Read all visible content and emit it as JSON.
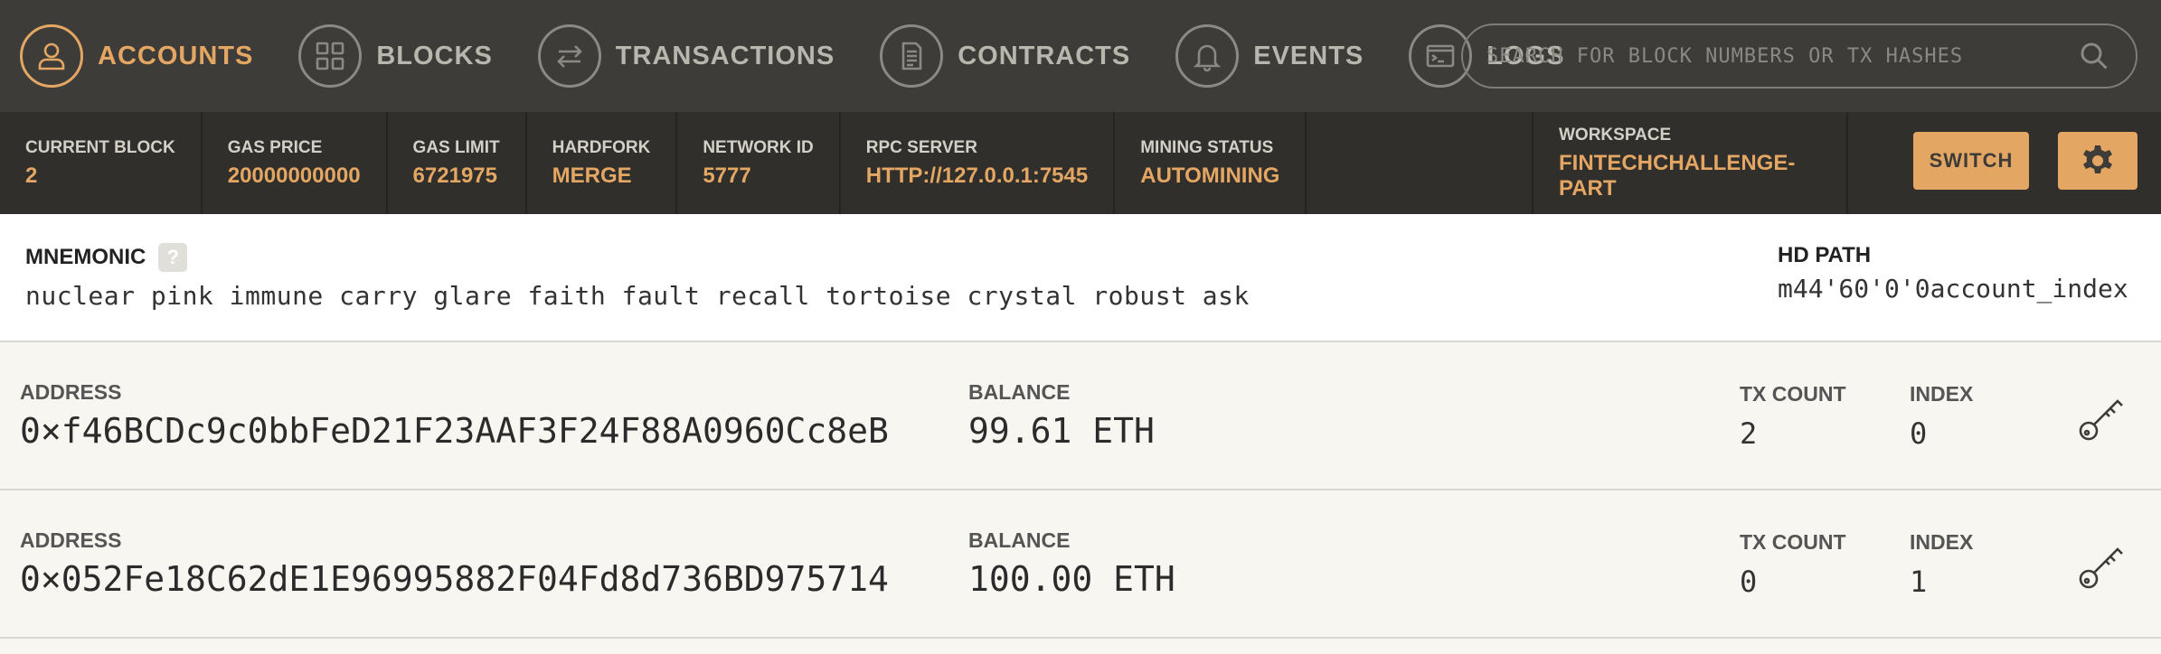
{
  "nav": {
    "items": [
      {
        "label": "ACCOUNTS",
        "icon": "user-icon",
        "active": true
      },
      {
        "label": "BLOCKS",
        "icon": "grid-icon",
        "active": false
      },
      {
        "label": "TRANSACTIONS",
        "icon": "arrows-icon",
        "active": false
      },
      {
        "label": "CONTRACTS",
        "icon": "document-icon",
        "active": false
      },
      {
        "label": "EVENTS",
        "icon": "bell-icon",
        "active": false
      },
      {
        "label": "LOGS",
        "icon": "terminal-icon",
        "active": false
      }
    ],
    "search_placeholder": "SEARCH FOR BLOCK NUMBERS OR TX HASHES"
  },
  "status": {
    "current_block": {
      "label": "CURRENT BLOCK",
      "value": "2"
    },
    "gas_price": {
      "label": "GAS PRICE",
      "value": "20000000000"
    },
    "gas_limit": {
      "label": "GAS LIMIT",
      "value": "6721975"
    },
    "hardfork": {
      "label": "HARDFORK",
      "value": "MERGE"
    },
    "network_id": {
      "label": "NETWORK ID",
      "value": "5777"
    },
    "rpc_server": {
      "label": "RPC SERVER",
      "value": "HTTP://127.0.0.1:7545"
    },
    "mining_status": {
      "label": "MINING STATUS",
      "value": "AUTOMINING"
    },
    "workspace": {
      "label": "WORKSPACE",
      "value": "FINTECHCHALLENGE-PART"
    },
    "switch_label": "SWITCH"
  },
  "mnemonic": {
    "label": "MNEMONIC",
    "help": "?",
    "words": "nuclear pink immune carry glare faith fault recall tortoise crystal robust ask",
    "hd_path_label": "HD PATH",
    "hd_path_value": "m44'60'0'0account_index"
  },
  "accounts": [
    {
      "address_label": "ADDRESS",
      "address": "0×f46BCDc9c0bbFeD21F23AAF3F24F88A0960Cc8eB",
      "balance_label": "BALANCE",
      "balance": "99.61 ETH",
      "tx_label": "TX COUNT",
      "tx_count": "2",
      "index_label": "INDEX",
      "index": "0"
    },
    {
      "address_label": "ADDRESS",
      "address": "0×052Fe18C62dE1E96995882F04Fd8d736BD975714",
      "balance_label": "BALANCE",
      "balance": "100.00 ETH",
      "tx_label": "TX COUNT",
      "tx_count": "0",
      "index_label": "INDEX",
      "index": "1"
    }
  ],
  "colors": {
    "accent": "#e4a663",
    "nav_bg": "#3d3c38",
    "status_bg": "#302f2c"
  }
}
